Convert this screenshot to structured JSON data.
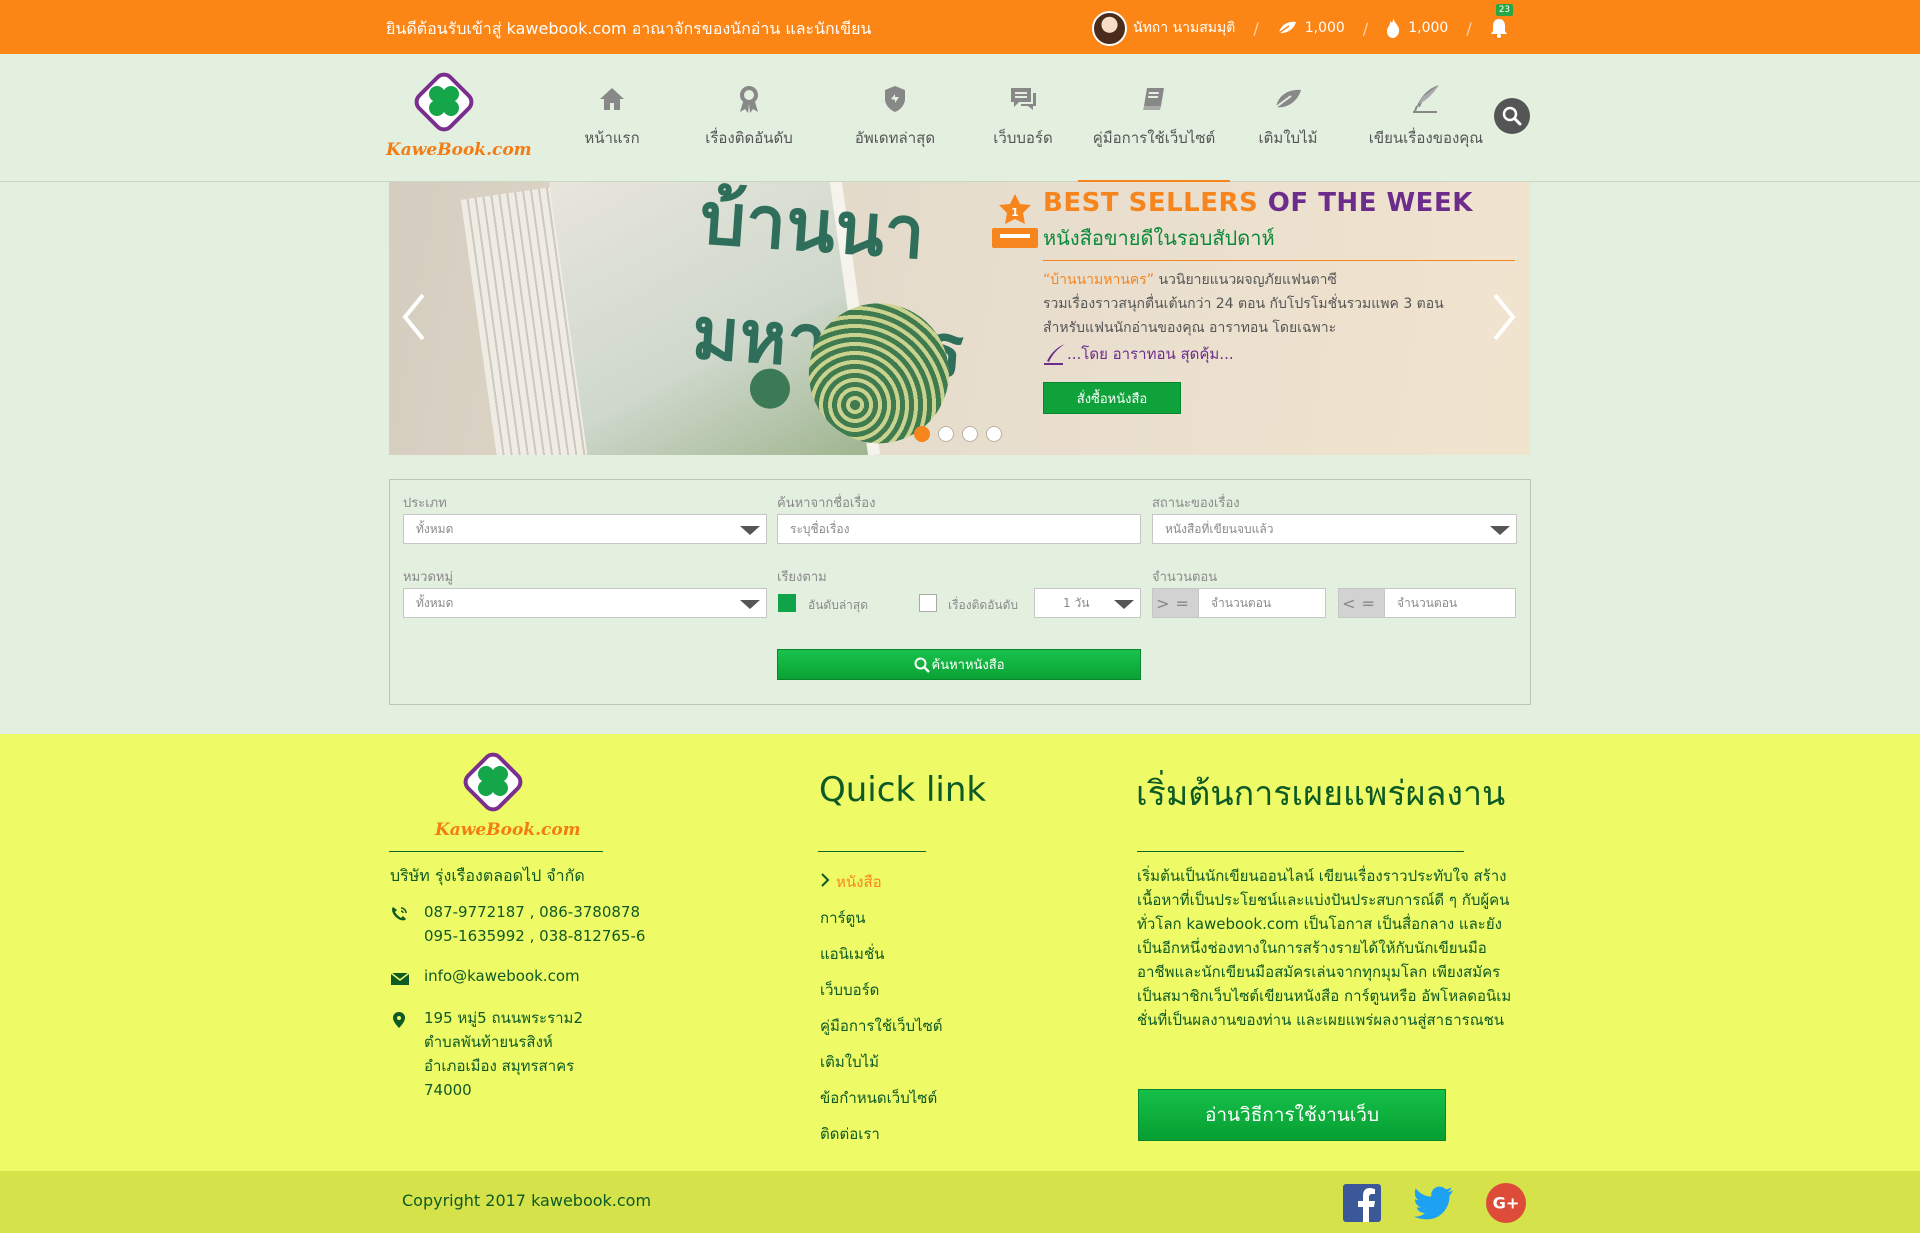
{
  "topbar": {
    "welcome": "ยินดีต้อนรับเข้าสู่ kawebook.com อาณาจักรของนักอ่าน และนักเขียน",
    "username": "นัทถา นามสมมุติ",
    "leaves": "1,000",
    "fire": "1,000",
    "notifications": "23"
  },
  "logo": {
    "text": "KaweBook.com"
  },
  "nav": {
    "items": [
      {
        "label": "หน้าแรก",
        "icon": "home-icon"
      },
      {
        "label": "เรื่องติดอันดับ",
        "icon": "award-icon"
      },
      {
        "label": "อัพเดทล่าสุด",
        "icon": "update-shield-icon"
      },
      {
        "label": "เว็บบอร์ด",
        "icon": "chat-icon"
      },
      {
        "label": "คู่มือการใช้เว็บไซต์",
        "icon": "book-icon"
      },
      {
        "label": "เติมใบไม้",
        "icon": "leaf-icon"
      },
      {
        "label": "เขียนเรื่องของคุณ",
        "icon": "quill-icon"
      }
    ],
    "active_index": 4
  },
  "banner": {
    "book_title": "บ้านนามหานคร",
    "book_author": "อาราทอน",
    "title_part1": "BEST SELLERS",
    "title_part2": "OF THE WEEK",
    "rank": "1",
    "subtitle": "หนังสือขายดีในรอบสัปดาห์",
    "desc_highlight": "“บ้านนามหานคร”",
    "desc_line1": " นวนิยายแนวผจญภัยแฟนตาซี",
    "desc_line2": "รวมเรื่องราวสนุกตื่นเต้นกว่า 24 ตอน กับโปรโมชั่นรวมแพค 3 ตอน",
    "desc_line3": "สำหรับแฟนนักอ่านของคุณ อาราทอน โดยเฉพาะ",
    "by": "...โดย อาราทอน สุดคุ้ม...",
    "button": "สั่งซื้อหนังสือ",
    "slides": 4,
    "current_slide": 0
  },
  "search": {
    "type_label": "ประเภท",
    "type_value": "ทั้งหมด",
    "name_label": "ค้นหาจากชื่อเรื่อง",
    "name_placeholder": "ระบุชื่อเรื่อง",
    "status_label": "สถานะของเรื่อง",
    "status_value": "หนังสือที่เขียนจบแล้ว",
    "category_label": "หมวดหมู่",
    "category_value": "ทั้งหมด",
    "sort_label": "เรียงตาม",
    "sort_opt1": "อันดับล่าสุด",
    "sort_opt2": "เรื่องติดอันดับ",
    "sort_period": "1 วัน",
    "episodes_label": "จำนวนตอน",
    "op_gte": ">=",
    "op_lte": "<=",
    "episodes_placeholder": "จำนวนตอน",
    "button": "ค้นหาหนังสือ"
  },
  "footer": {
    "company": "บริษัท รุ่งเรืองตลอดไป จำกัด",
    "phone1": "087-9772187 , 086-3780878",
    "phone2": "095-1635992 , 038-812765-6",
    "email": "info@kawebook.com",
    "addr1": "195 หมู่5 ถนนพระราม2",
    "addr2": "ตำบลพันท้ายนรสิงห์",
    "addr3": "อำเภอเมือง สมุทรสาคร",
    "addr4": "74000",
    "quick_title": "Quick link",
    "quick_links": [
      "หนังสือ",
      "การ์ตูน",
      "แอนิเมชั่น",
      "เว็บบอร์ด",
      "คู่มือการใช้เว็บไซต์",
      "เติมใบไม้",
      "ข้อกำหนดเว็บไซต์",
      "ติดต่อเรา"
    ],
    "start_title": "เริ่มต้นการเผยแพร่ผลงาน",
    "start_desc": "เริ่มต้นเป็นนักเขียนออนไลน์ เขียนเรื่องราวประทับใจ สร้างเนื้อหาที่เป็นประโยชน์และแบ่งปันประสบการณ์ดี ๆ กับผู้คนทั่วโลก kawebook.com เป็นโอกาส เป็นสื่อกลาง และยังเป็นอีกหนึ่งช่องทางในการสร้างรายได้ให้กับนักเขียนมืออาชีพและนักเขียนมือสมัครเล่นจากทุกมุมโลก เพียงสมัครเป็นสมาชิกเว็บไซต์เขียนหนังสือ การ์ตูนหรือ อัพโหลดอนิเมชั่นที่เป็นผลงานของท่าน และเผยแพร่ผลงานสู่สาธารณชน",
    "start_button": "อ่านวิธีการใช้งานเว็บ",
    "copyright": "Copyright 2017 kawebook.com"
  },
  "colors": {
    "orange": "#fb8515",
    "green": "#0fa23a",
    "purple": "#6c2c8c",
    "footer_bg": "#eefb66"
  }
}
